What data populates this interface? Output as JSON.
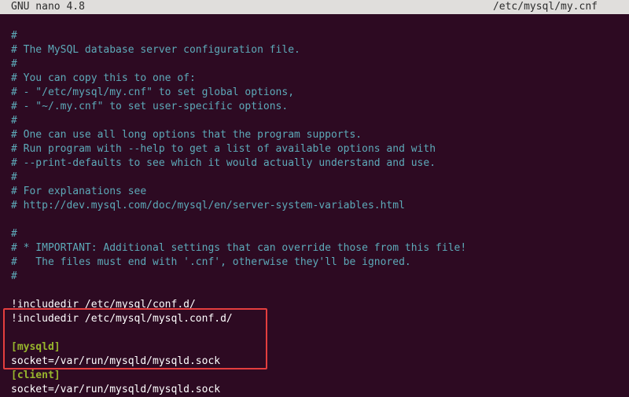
{
  "titlebar": {
    "app": "GNU nano 4.8",
    "filepath": "/etc/mysql/my.cnf"
  },
  "comments": {
    "l1": "#",
    "l2": "# The MySQL database server configuration file.",
    "l3": "#",
    "l4": "# You can copy this to one of:",
    "l5": "# - \"/etc/mysql/my.cnf\" to set global options,",
    "l6": "# - \"~/.my.cnf\" to set user-specific options.",
    "l7": "#",
    "l8": "# One can use all long options that the program supports.",
    "l9": "# Run program with --help to get a list of available options and with",
    "l10": "# --print-defaults to see which it would actually understand and use.",
    "l11": "#",
    "l12": "# For explanations see",
    "l13": "# http://dev.mysql.com/doc/mysql/en/server-system-variables.html",
    "l14b": "#",
    "l15": "# * IMPORTANT: Additional settings that can override those from this file!",
    "l16": "#   The files must end with '.cnf', otherwise they'll be ignored.",
    "l17": "#"
  },
  "includes": {
    "inc1": "!includedir /etc/mysql/conf.d/",
    "inc2": "!includedir /etc/mysql/mysql.conf.d/"
  },
  "sections": {
    "mysqld_header": "[mysqld]",
    "mysqld_line": "socket=/var/run/mysqld/mysqld.sock",
    "client_header": "[client]",
    "client_line": "socket=/var/run/mysqld/mysqld.sock"
  }
}
